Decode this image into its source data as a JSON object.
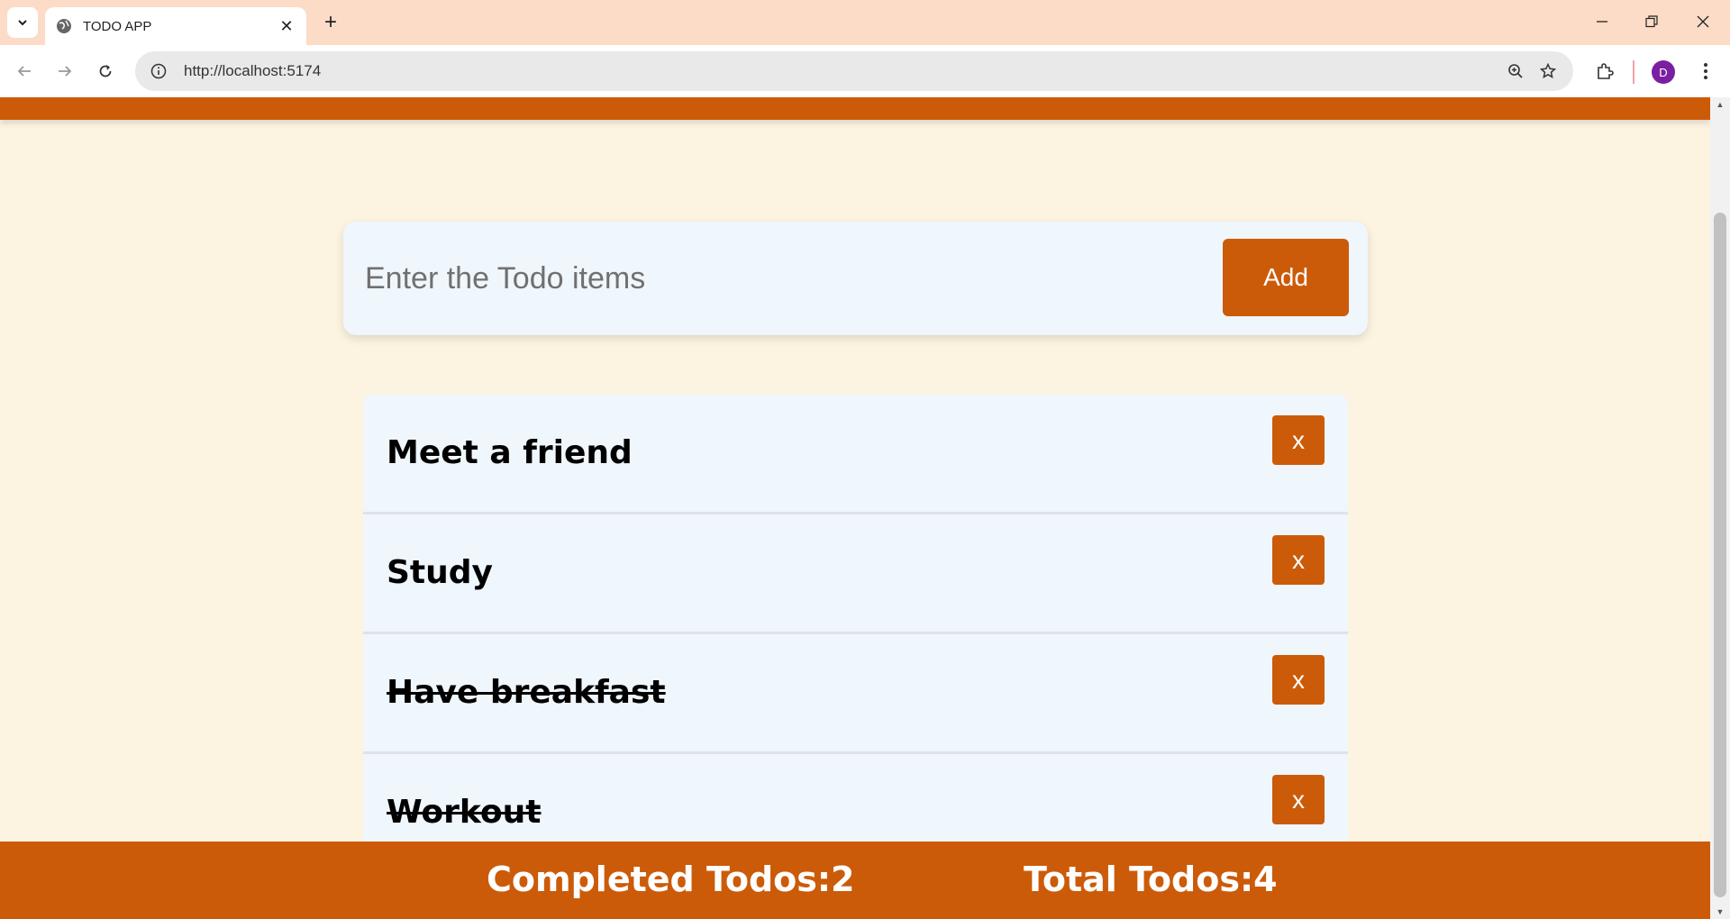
{
  "browser": {
    "tab_title": "TODO APP",
    "new_tab_symbol": "+",
    "close_symbol": "✕",
    "url": "http://localhost:5174",
    "profile_initial": "D"
  },
  "form": {
    "placeholder": "Enter the Todo items",
    "add_label": "Add"
  },
  "todos": [
    {
      "text": "Meet a friend",
      "completed": false,
      "delete_label": "x"
    },
    {
      "text": "Study",
      "completed": false,
      "delete_label": "x"
    },
    {
      "text": "Have breakfast",
      "completed": true,
      "delete_label": "x"
    },
    {
      "text": "Workout",
      "completed": true,
      "delete_label": "x"
    }
  ],
  "footer": {
    "completed_label": "Completed Todos:2",
    "total_label": "Total Todos:4"
  },
  "colors": {
    "accent": "#cc5b09",
    "page_bg": "#fdf3e1",
    "card_bg": "#eff6fc",
    "tabbar_bg": "#fcdcc7"
  }
}
